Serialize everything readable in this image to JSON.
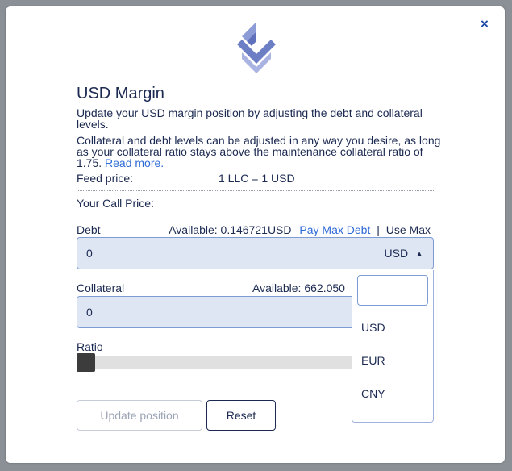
{
  "modal": {
    "close_label": "×",
    "title": "USD Margin",
    "intro": "Update your USD margin position by adjusting the debt and collateral levels.",
    "description": "Collateral and debt levels can be adjusted in any way you desire, as long as your collateral ratio stays above the maintenance collateral ratio of 1.75.",
    "read_more": "Read more.",
    "feed_price_label": "Feed price:",
    "feed_price_value": "1 LLC = 1 USD",
    "call_price_label": "Your Call Price:"
  },
  "debt": {
    "label": "Debt",
    "available": "Available: 0.146721USD",
    "pay_max": "Pay Max Debt",
    "separator": "|",
    "use_max": "Use Max",
    "value": "0",
    "asset": "USD"
  },
  "collateral": {
    "label": "Collateral",
    "available": "Available: 662.050",
    "value": "0"
  },
  "ratio": {
    "label": "Ratio",
    "level": 0
  },
  "dropdown": {
    "search_value": "",
    "options": [
      "USD",
      "EUR",
      "CNY"
    ]
  },
  "buttons": {
    "update": "Update position",
    "reset": "Reset"
  },
  "colors": {
    "accent": "#2e6bd6",
    "text": "#1c2a52",
    "input_bg": "#dfe6f3",
    "logo": "#6d7fc4"
  },
  "icons": {
    "close": "close-icon",
    "logo": "logo-icon",
    "caret": "caret-up-icon"
  }
}
